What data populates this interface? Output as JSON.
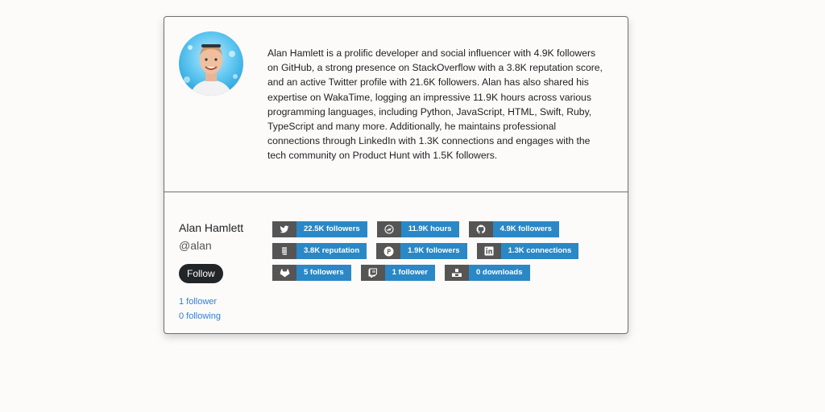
{
  "profile": {
    "name": "Alan Hamlett",
    "handle": "@alan",
    "follow_label": "Follow",
    "followers_link": "1 follower",
    "following_link": "0 following",
    "bio": "Alan Hamlett is a prolific developer and social influencer with 4.9K followers on GitHub, a strong presence on StackOverflow with a 3.8K reputation score, and an active Twitter profile with 21.6K followers. Alan has also shared his expertise on WakaTime, logging an impressive 11.9K hours across various programming languages, including Python, JavaScript, HTML, Swift, Ruby, TypeScript and many more. Additionally, he maintains professional connections through LinkedIn with 1.3K connections and engages with the tech community on Product Hunt with 1.5K followers."
  },
  "badges": {
    "twitter": {
      "icon": "twitter-icon",
      "value": "22.5K followers"
    },
    "wakatime": {
      "icon": "wakatime-icon",
      "value": "11.9K hours"
    },
    "github": {
      "icon": "github-icon",
      "value": "4.9K followers"
    },
    "stackoverflow": {
      "icon": "stackoverflow-icon",
      "value": "3.8K reputation"
    },
    "producthunt": {
      "icon": "producthunt-icon",
      "value": "1.9K followers"
    },
    "linkedin": {
      "icon": "linkedin-icon",
      "value": "1.3K connections"
    },
    "gitlab": {
      "icon": "gitlab-icon",
      "value": "5 followers"
    },
    "twitch": {
      "icon": "twitch-icon",
      "value": "1 follower"
    },
    "downloads": {
      "icon": "downloads-icon",
      "value": "0 downloads"
    }
  },
  "colors": {
    "badge_value_bg": "#2a88c6",
    "badge_icon_bg": "#555555",
    "follow_button_bg": "#222528",
    "link": "#2f7fd6"
  }
}
